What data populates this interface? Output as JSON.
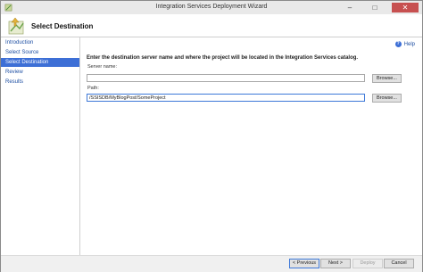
{
  "window": {
    "title": "Integration Services Deployment Wizard"
  },
  "header": {
    "title": "Select Destination"
  },
  "nav": {
    "items": [
      {
        "label": "Introduction"
      },
      {
        "label": "Select Source"
      },
      {
        "label": "Select Destination"
      },
      {
        "label": "Review"
      },
      {
        "label": "Results"
      }
    ],
    "active_index": 2
  },
  "main": {
    "help_label": "Help",
    "instruction": "Enter the destination server name and where the project will be located in the Integration Services catalog.",
    "server": {
      "label": "Server name:",
      "value": "",
      "browse_label": "Browse..."
    },
    "path": {
      "label": "Path:",
      "value": "/SSISDB/MyBlogPost/SomeProject",
      "browse_label": "Browse..."
    }
  },
  "footer": {
    "previous_label": "< Previous",
    "next_label": "Next >",
    "deploy_label": "Deploy",
    "cancel_label": "Cancel"
  },
  "colors": {
    "accent": "#3d6fd6",
    "link": "#1e4fa3",
    "close": "#c75050"
  },
  "icons": [
    "wizard-app-icon",
    "minimize-icon",
    "maximize-icon",
    "close-icon",
    "help-icon",
    "deployment-wizard-icon"
  ]
}
